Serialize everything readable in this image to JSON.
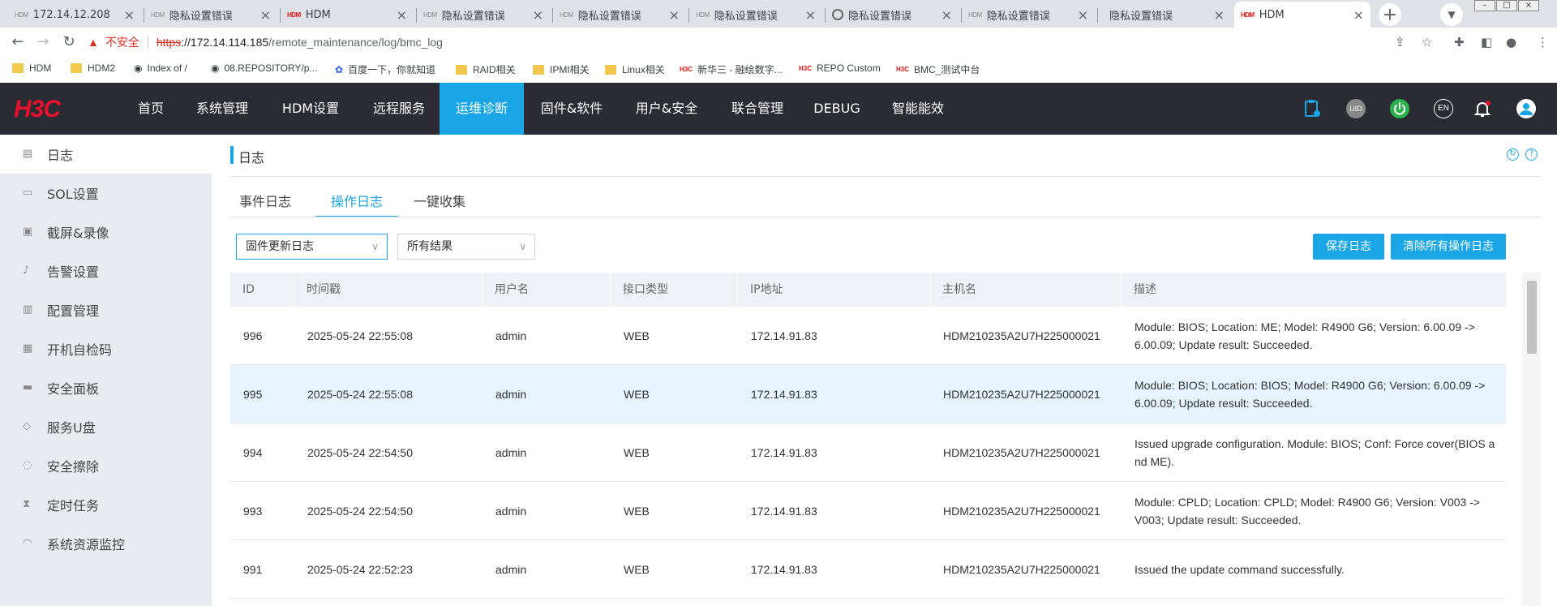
{
  "browser": {
    "tabs": [
      {
        "favicon": "HDM",
        "title": "172.14.12.208"
      },
      {
        "favicon": "HDM",
        "title": "隐私设置错误"
      },
      {
        "favicon": "HDM",
        "title": "HDM"
      },
      {
        "favicon": "HDM",
        "title": "隐私设置错误"
      },
      {
        "favicon": "HDM",
        "title": "隐私设置错误"
      },
      {
        "favicon": "HDM",
        "title": "隐私设置错误"
      },
      {
        "favicon": "globe-icon",
        "title": "隐私设置错误"
      },
      {
        "favicon": "HDM",
        "title": "隐私设置错误"
      },
      {
        "favicon": "",
        "title": "隐私设置错误"
      },
      {
        "favicon": "HDM",
        "title": "HDM"
      }
    ],
    "active_tab_index": 9,
    "address": {
      "security_label": "不安全",
      "scheme": "https",
      "host": "://172.14.114.185",
      "path": "/remote_maintenance/log/bmc_log"
    },
    "bookmarks": [
      {
        "icon": "folder",
        "label": "HDM"
      },
      {
        "icon": "folder",
        "label": "HDM2"
      },
      {
        "icon": "globe",
        "label": "Index of /"
      },
      {
        "icon": "globe",
        "label": "08.REPOSITORY/p..."
      },
      {
        "icon": "paw",
        "label": "百度一下，你就知道"
      },
      {
        "icon": "folder",
        "label": "RAID相关"
      },
      {
        "icon": "folder",
        "label": "IPMI相关"
      },
      {
        "icon": "folder",
        "label": "Linux相关"
      },
      {
        "icon": "H3C",
        "label": "新华三 - 融绘数字..."
      },
      {
        "icon": "H3C",
        "label": "REPO Custom"
      },
      {
        "icon": "H3C",
        "label": "BMC_测试中台"
      }
    ]
  },
  "header": {
    "logo": "H3C",
    "nav": [
      "首页",
      "系统管理",
      "HDM设置",
      "远程服务",
      "运维诊断",
      "固件&软件",
      "用户&安全",
      "联合管理",
      "DEBUG",
      "智能能效"
    ],
    "active_nav": "运维诊断",
    "uid_label": "UID",
    "lang_label": "EN",
    "colors": {
      "bg": "#2b2b33",
      "accent": "#1aa6e6",
      "power": "#2bb24c"
    }
  },
  "sidebar": {
    "items": [
      {
        "icon": "log-icon",
        "label": "日志"
      },
      {
        "icon": "sol-icon",
        "label": "SOL设置"
      },
      {
        "icon": "screenshot-icon",
        "label": "截屏&录像"
      },
      {
        "icon": "bell-icon",
        "label": "告警设置"
      },
      {
        "icon": "config-icon",
        "label": "配置管理"
      },
      {
        "icon": "post-code-icon",
        "label": "开机自检码"
      },
      {
        "icon": "panel-icon",
        "label": "安全面板"
      },
      {
        "icon": "usb-icon",
        "label": "服务U盘"
      },
      {
        "icon": "erase-icon",
        "label": "安全擦除"
      },
      {
        "icon": "hourglass-icon",
        "label": "定时任务"
      },
      {
        "icon": "monitor-icon",
        "label": "系统资源监控"
      }
    ],
    "active_index": 0
  },
  "main": {
    "title": "日志",
    "tabs": [
      "事件日志",
      "操作日志",
      "一键收集"
    ],
    "active_tab": "操作日志",
    "filter_type": "固件更新日志",
    "filter_result": "所有结果",
    "save_button": "保存日志",
    "clear_button": "清除所有操作日志",
    "columns": [
      "ID",
      "时间戳",
      "用户名",
      "接口类型",
      "IP地址",
      "主机名",
      "描述"
    ],
    "rows": [
      {
        "id": "996",
        "time": "2025-05-24 22:55:08",
        "user": "admin",
        "iface": "WEB",
        "ip": "172.14.91.83",
        "host": "HDM210235A2U7H225000021",
        "desc": "Module: BIOS; Location: ME; Model: R4900 G6; Version: 6.00.09 -> 6.00.09; Update result: Succeeded."
      },
      {
        "id": "995",
        "time": "2025-05-24 22:55:08",
        "user": "admin",
        "iface": "WEB",
        "ip": "172.14.91.83",
        "host": "HDM210235A2U7H225000021",
        "desc": "Module: BIOS; Location: BIOS; Model: R4900 G6; Version: 6.00.09 -> 6.00.09; Update result: Succeeded."
      },
      {
        "id": "994",
        "time": "2025-05-24 22:54:50",
        "user": "admin",
        "iface": "WEB",
        "ip": "172.14.91.83",
        "host": "HDM210235A2U7H225000021",
        "desc": "Issued upgrade configuration. Module: BIOS; Conf: Force cover(BIOS and ME)."
      },
      {
        "id": "993",
        "time": "2025-05-24 22:54:50",
        "user": "admin",
        "iface": "WEB",
        "ip": "172.14.91.83",
        "host": "HDM210235A2U7H225000021",
        "desc": "Module: CPLD; Location: CPLD; Model: R4900 G6; Version: V003 -> V003; Update result: Succeeded."
      },
      {
        "id": "991",
        "time": "2025-05-24 22:52:23",
        "user": "admin",
        "iface": "WEB",
        "ip": "172.14.91.83",
        "host": "HDM210235A2U7H225000021",
        "desc": "Issued the update command successfully."
      }
    ]
  }
}
